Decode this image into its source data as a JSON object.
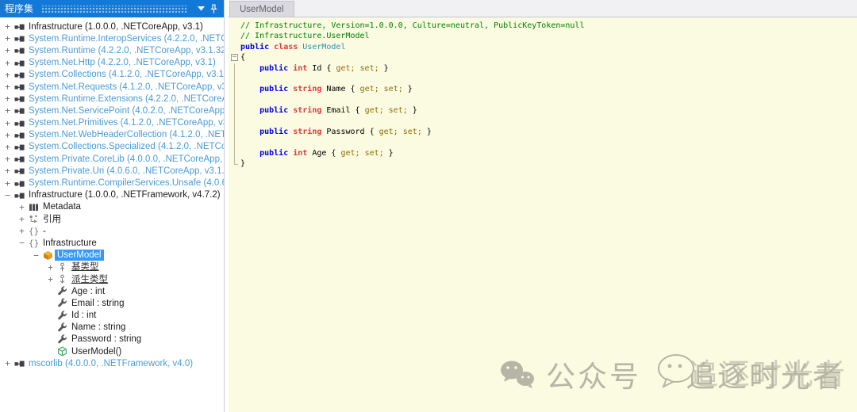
{
  "left_panel": {
    "title": "程序集",
    "tree": [
      {
        "level": 0,
        "expander": "+",
        "icon": "assembly",
        "label": "Infrastructure (1.0.0.0, .NETCoreApp, v3.1)"
      },
      {
        "level": 0,
        "expander": "+",
        "icon": "assembly",
        "label": "System.Runtime.InteropServices (4.2.2.0, .NETC",
        "blue": true
      },
      {
        "level": 0,
        "expander": "+",
        "icon": "assembly",
        "label": "System.Runtime (4.2.2.0, .NETCoreApp, v3.1.32",
        "blue": true
      },
      {
        "level": 0,
        "expander": "+",
        "icon": "assembly",
        "label": "System.Net.Http (4.2.2.0, .NETCoreApp, v3.1)",
        "blue": true
      },
      {
        "level": 0,
        "expander": "+",
        "icon": "assembly",
        "label": "System.Collections (4.1.2.0, .NETCoreApp, v3.1)",
        "blue": true
      },
      {
        "level": 0,
        "expander": "+",
        "icon": "assembly",
        "label": "System.Net.Requests (4.1.2.0, .NETCoreApp, v3",
        "blue": true
      },
      {
        "level": 0,
        "expander": "+",
        "icon": "assembly",
        "label": "System.Runtime.Extensions (4.2.2.0, .NETCoreA",
        "blue": true
      },
      {
        "level": 0,
        "expander": "+",
        "icon": "assembly",
        "label": "System.Net.ServicePoint (4.0.2.0, .NETCoreApp",
        "blue": true
      },
      {
        "level": 0,
        "expander": "+",
        "icon": "assembly",
        "label": "System.Net.Primitives (4.1.2.0, .NETCoreApp, v3",
        "blue": true
      },
      {
        "level": 0,
        "expander": "+",
        "icon": "assembly",
        "label": "System.Net.WebHeaderCollection (4.1.2.0, .NET",
        "blue": true
      },
      {
        "level": 0,
        "expander": "+",
        "icon": "assembly",
        "label": "System.Collections.Specialized (4.1.2.0, .NETCo",
        "blue": true
      },
      {
        "level": 0,
        "expander": "+",
        "icon": "assembly",
        "label": "System.Private.CoreLib (4.0.0.0, .NETCoreApp,",
        "blue": true
      },
      {
        "level": 0,
        "expander": "+",
        "icon": "assembly",
        "label": "System.Private.Uri (4.0.6.0, .NETCoreApp, v3.1.",
        "blue": true
      },
      {
        "level": 0,
        "expander": "+",
        "icon": "assembly",
        "label": "System.Runtime.CompilerServices.Unsafe (4.0.6",
        "blue": true
      },
      {
        "level": 0,
        "expander": "-",
        "icon": "assembly",
        "label": "Infrastructure (1.0.0.0, .NETFramework, v4.7.2)"
      },
      {
        "level": 1,
        "expander": "+",
        "icon": "metadata",
        "label": "Metadata"
      },
      {
        "level": 1,
        "expander": "+",
        "icon": "references",
        "label": "引用"
      },
      {
        "level": 1,
        "expander": "+",
        "icon": "namespace",
        "label": "-"
      },
      {
        "level": 1,
        "expander": "-",
        "icon": "namespace",
        "label": "Infrastructure"
      },
      {
        "level": 2,
        "expander": "-",
        "icon": "class",
        "label": "UserModel",
        "selected": true
      },
      {
        "level": 3,
        "expander": "+",
        "icon": "base-types",
        "label": "基类型",
        "underline": true
      },
      {
        "level": 3,
        "expander": "+",
        "icon": "derived-types",
        "label": "派生类型",
        "underline": true
      },
      {
        "level": 3,
        "expander": "",
        "icon": "property",
        "label": "Age : int"
      },
      {
        "level": 3,
        "expander": "",
        "icon": "property",
        "label": "Email : string"
      },
      {
        "level": 3,
        "expander": "",
        "icon": "property",
        "label": "Id : int"
      },
      {
        "level": 3,
        "expander": "",
        "icon": "property",
        "label": "Name : string"
      },
      {
        "level": 3,
        "expander": "",
        "icon": "property",
        "label": "Password : string"
      },
      {
        "level": 3,
        "expander": "",
        "icon": "method",
        "label": "UserModel()"
      },
      {
        "level": 0,
        "expander": "+",
        "icon": "assembly",
        "label": "mscorlib (4.0.0.0, .NETFramework, v4.0)",
        "blue": true
      }
    ]
  },
  "editor": {
    "tab": "UserModel",
    "lines": [
      {
        "fold": "",
        "tokens": [
          {
            "t": "// Infrastructure, Version=1.0.0.0, Culture=neutral, PublicKeyToken=null",
            "c": "com"
          }
        ]
      },
      {
        "fold": "",
        "tokens": [
          {
            "t": "// Infrastructure.UserModel",
            "c": "com"
          }
        ]
      },
      {
        "fold": "",
        "tokens": [
          {
            "t": "public ",
            "c": "kw"
          },
          {
            "t": "class ",
            "c": "ty"
          },
          {
            "t": "UserModel",
            "c": "cn"
          }
        ]
      },
      {
        "fold": "start",
        "tokens": [
          {
            "t": "{",
            "c": "pl"
          }
        ]
      },
      {
        "fold": "mid",
        "tokens": [
          {
            "t": "    ",
            "c": "pl"
          },
          {
            "t": "public ",
            "c": "kw"
          },
          {
            "t": "int",
            "c": "ty"
          },
          {
            "t": " Id { ",
            "c": "pl"
          },
          {
            "t": "get; set;",
            "c": "ac"
          },
          {
            "t": " }",
            "c": "pl"
          }
        ]
      },
      {
        "fold": "mid",
        "tokens": []
      },
      {
        "fold": "mid",
        "tokens": [
          {
            "t": "    ",
            "c": "pl"
          },
          {
            "t": "public ",
            "c": "kw"
          },
          {
            "t": "string",
            "c": "ty"
          },
          {
            "t": " Name { ",
            "c": "pl"
          },
          {
            "t": "get; set;",
            "c": "ac"
          },
          {
            "t": " }",
            "c": "pl"
          }
        ]
      },
      {
        "fold": "mid",
        "tokens": []
      },
      {
        "fold": "mid",
        "tokens": [
          {
            "t": "    ",
            "c": "pl"
          },
          {
            "t": "public ",
            "c": "kw"
          },
          {
            "t": "string",
            "c": "ty"
          },
          {
            "t": " Email { ",
            "c": "pl"
          },
          {
            "t": "get; set;",
            "c": "ac"
          },
          {
            "t": " }",
            "c": "pl"
          }
        ]
      },
      {
        "fold": "mid",
        "tokens": []
      },
      {
        "fold": "mid",
        "tokens": [
          {
            "t": "    ",
            "c": "pl"
          },
          {
            "t": "public ",
            "c": "kw"
          },
          {
            "t": "string",
            "c": "ty"
          },
          {
            "t": " Password { ",
            "c": "pl"
          },
          {
            "t": "get; set;",
            "c": "ac"
          },
          {
            "t": " }",
            "c": "pl"
          }
        ]
      },
      {
        "fold": "mid",
        "tokens": []
      },
      {
        "fold": "mid",
        "tokens": [
          {
            "t": "    ",
            "c": "pl"
          },
          {
            "t": "public ",
            "c": "kw"
          },
          {
            "t": "int",
            "c": "ty"
          },
          {
            "t": " Age { ",
            "c": "pl"
          },
          {
            "t": "get; set;",
            "c": "ac"
          },
          {
            "t": " }",
            "c": "pl"
          }
        ]
      },
      {
        "fold": "end",
        "tokens": [
          {
            "t": "}",
            "c": "pl"
          }
        ]
      }
    ]
  },
  "watermark": {
    "label": "公众号",
    "name": "追逐时光者"
  },
  "colors": {
    "panel_header_bg": "#1379d8",
    "selection_bg": "#3399ff",
    "assembly_link_blue": "#4a9bd5",
    "code_bg": "#fbfbe1",
    "comment_green": "#008000",
    "keyword_blue": "#0101e6",
    "type_keyword_red": "#dd3a3a",
    "class_name_teal": "#2e91af",
    "accessor_olive": "#8f6d00",
    "tab_bg": "#d9d9df",
    "tab_strip_bg": "#f1f1f3",
    "watermark_gray": "#a4a396"
  }
}
